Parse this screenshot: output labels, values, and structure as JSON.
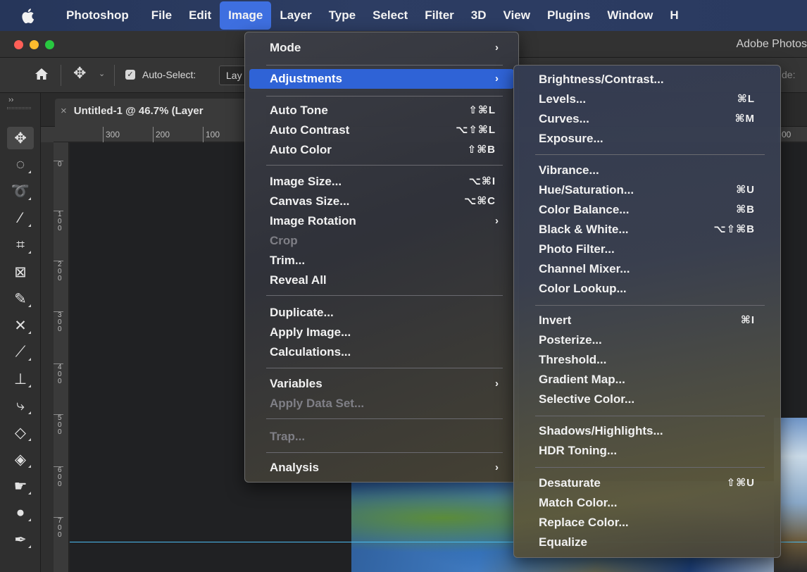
{
  "menubar": {
    "app_name": "Photoshop",
    "items": [
      "File",
      "Edit",
      "Image",
      "Layer",
      "Type",
      "Select",
      "Filter",
      "3D",
      "View",
      "Plugins",
      "Window",
      "H"
    ],
    "active_item": "Image"
  },
  "titlebar": {
    "title": "Adobe Photos"
  },
  "options": {
    "auto_select_label": "Auto-Select:",
    "layer_dropdown": "Lay",
    "right_label": "de:"
  },
  "document": {
    "tab_title": "Untitled-1 @ 46.7% (Layer",
    "close_glyph": "×",
    "ruler_h": [
      "300",
      "200",
      "100",
      "00"
    ],
    "ruler_v": [
      "0",
      "100",
      "200",
      "300",
      "400",
      "500",
      "600",
      "700"
    ]
  },
  "image_menu": {
    "items": [
      {
        "label": "Mode",
        "shortcut": "",
        "submenu": true
      },
      {
        "label": "Adjustments",
        "shortcut": "",
        "submenu": true,
        "highlighted": true
      },
      {
        "label": "Auto Tone",
        "shortcut": "⇧⌘L"
      },
      {
        "label": "Auto Contrast",
        "shortcut": "⌥⇧⌘L"
      },
      {
        "label": "Auto Color",
        "shortcut": "⇧⌘B"
      },
      {
        "label": "Image Size...",
        "shortcut": "⌥⌘I"
      },
      {
        "label": "Canvas Size...",
        "shortcut": "⌥⌘C"
      },
      {
        "label": "Image Rotation",
        "shortcut": "",
        "submenu": true
      },
      {
        "label": "Crop",
        "shortcut": "",
        "disabled": true
      },
      {
        "label": "Trim...",
        "shortcut": ""
      },
      {
        "label": "Reveal All",
        "shortcut": ""
      },
      {
        "label": "Duplicate...",
        "shortcut": ""
      },
      {
        "label": "Apply Image...",
        "shortcut": ""
      },
      {
        "label": "Calculations...",
        "shortcut": ""
      },
      {
        "label": "Variables",
        "shortcut": "",
        "submenu": true
      },
      {
        "label": "Apply Data Set...",
        "shortcut": "",
        "disabled": true
      },
      {
        "label": "Trap...",
        "shortcut": "",
        "disabled": true
      },
      {
        "label": "Analysis",
        "shortcut": "",
        "submenu": true
      }
    ]
  },
  "adjustments_menu": {
    "items": [
      {
        "label": "Brightness/Contrast...",
        "shortcut": ""
      },
      {
        "label": "Levels...",
        "shortcut": "⌘L"
      },
      {
        "label": "Curves...",
        "shortcut": "⌘M"
      },
      {
        "label": "Exposure...",
        "shortcut": ""
      },
      {
        "label": "Vibrance...",
        "shortcut": ""
      },
      {
        "label": "Hue/Saturation...",
        "shortcut": "⌘U"
      },
      {
        "label": "Color Balance...",
        "shortcut": "⌘B"
      },
      {
        "label": "Black & White...",
        "shortcut": "⌥⇧⌘B"
      },
      {
        "label": "Photo Filter...",
        "shortcut": ""
      },
      {
        "label": "Channel Mixer...",
        "shortcut": ""
      },
      {
        "label": "Color Lookup...",
        "shortcut": ""
      },
      {
        "label": "Invert",
        "shortcut": "⌘I"
      },
      {
        "label": "Posterize...",
        "shortcut": ""
      },
      {
        "label": "Threshold...",
        "shortcut": ""
      },
      {
        "label": "Gradient Map...",
        "shortcut": ""
      },
      {
        "label": "Selective Color...",
        "shortcut": ""
      },
      {
        "label": "Shadows/Highlights...",
        "shortcut": ""
      },
      {
        "label": "HDR Toning...",
        "shortcut": ""
      },
      {
        "label": "Desaturate",
        "shortcut": "⇧⌘U"
      },
      {
        "label": "Match Color...",
        "shortcut": ""
      },
      {
        "label": "Replace Color...",
        "shortcut": ""
      },
      {
        "label": "Equalize",
        "shortcut": ""
      }
    ]
  },
  "colors": {
    "menubar_bg": "#2b3b61",
    "highlight": "#2f63d6",
    "guide_line": "#4bbdf3",
    "traffic_close": "#ff5f57",
    "traffic_min": "#febc2e",
    "traffic_max": "#28c840"
  },
  "tools": [
    "move-tool",
    "marquee-tool",
    "lasso-tool",
    "magic-wand-tool",
    "crop-tool",
    "frame-tool",
    "eyedropper-tool",
    "healing-tool",
    "brush-tool",
    "clone-stamp-tool",
    "history-brush-tool",
    "eraser-tool",
    "paint-bucket-tool",
    "smudge-tool",
    "dodge-tool",
    "pen-tool"
  ]
}
